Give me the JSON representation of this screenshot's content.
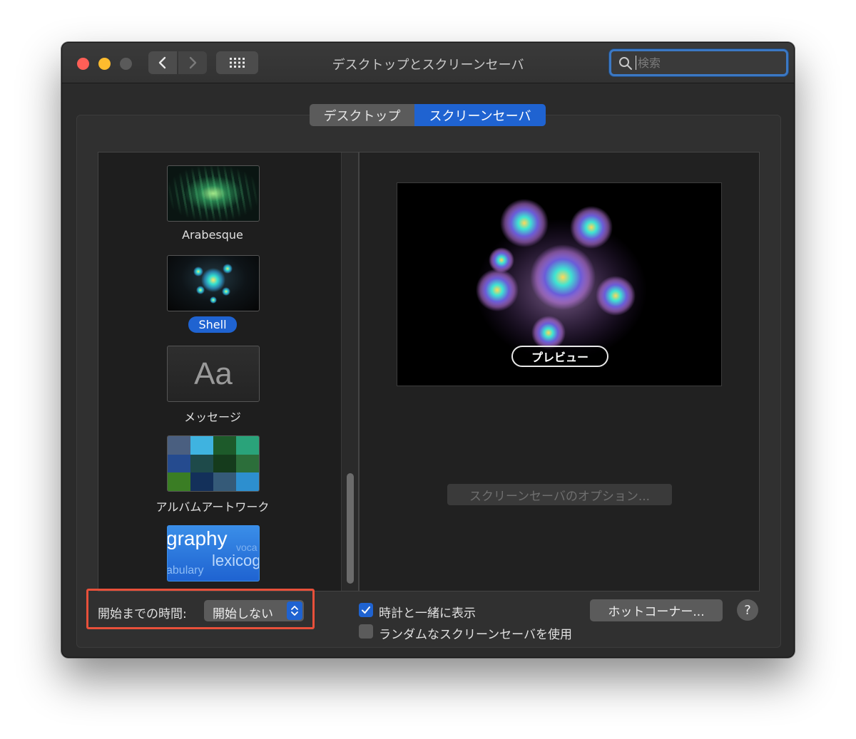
{
  "window": {
    "title": "デスクトップとスクリーンセーバ"
  },
  "search": {
    "placeholder": "検索"
  },
  "tabs": [
    {
      "label": "デスクトップ",
      "selected": false
    },
    {
      "label": "スクリーンセーバ",
      "selected": true
    }
  ],
  "screensavers": [
    {
      "label": "Arabesque",
      "selected": false
    },
    {
      "label": "Shell",
      "selected": true
    },
    {
      "label": "メッセージ",
      "selected": false,
      "thumb_text": "Aa"
    },
    {
      "label": "アルバムアートワーク",
      "selected": false
    },
    {
      "label": "",
      "selected": false,
      "thumb_words": [
        "graphy",
        "lexicog",
        "abulary",
        "voca"
      ]
    }
  ],
  "preview": {
    "button_label": "プレビュー"
  },
  "options_button": {
    "label": "スクリーンセーバのオプション..."
  },
  "start_after": {
    "label": "開始までの時間:",
    "value": "開始しない"
  },
  "show_clock": {
    "label": "時計と一緒に表示",
    "checked": true
  },
  "random": {
    "label": "ランダムなスクリーンセーバを使用",
    "checked": false
  },
  "hot_corners": {
    "label": "ホットコーナー..."
  },
  "help": {
    "label": "?"
  },
  "colors": {
    "accent": "#1f63d1",
    "highlight_box": "#e8503a",
    "close": "#ff5f57",
    "minimize": "#febc2e"
  }
}
